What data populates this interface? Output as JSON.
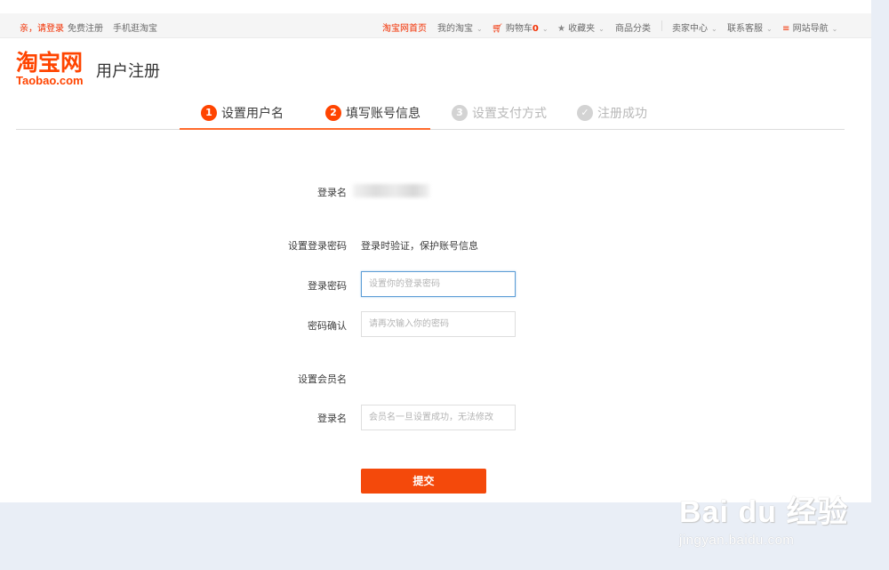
{
  "topbar": {
    "login": "亲，请登录",
    "register": "免费注册",
    "mobile": "手机逛淘宝",
    "home": "淘宝网首页",
    "my_taobao": "我的淘宝",
    "cart_label": "购物车",
    "cart_count": "0",
    "favorites": "收藏夹",
    "categories": "商品分类",
    "seller_center": "卖家中心",
    "customer_service": "联系客服",
    "site_nav": "网站导航"
  },
  "logo": {
    "cn": "淘宝网",
    "en": "Taobao.com"
  },
  "page_title": "用户注册",
  "steps": [
    {
      "num": "1",
      "label": "设置用户名",
      "state": "done"
    },
    {
      "num": "2",
      "label": "填写账号信息",
      "state": "current"
    },
    {
      "num": "3",
      "label": "设置支付方式",
      "state": "pending"
    },
    {
      "num": "✓",
      "label": "注册成功",
      "state": "pending"
    }
  ],
  "form": {
    "login_name_label": "登录名",
    "set_password_label": "设置登录密码",
    "set_password_desc": "登录时验证，保护账号信息",
    "password_label": "登录密码",
    "password_placeholder": "设置你的登录密码",
    "confirm_label": "密码确认",
    "confirm_placeholder": "请再次输入你的密码",
    "member_section_label": "设置会员名",
    "member_name_label": "登录名",
    "member_name_placeholder": "会员名一旦设置成功，无法修改",
    "submit_label": "提交"
  },
  "watermark": {
    "big": "Bai du 经验",
    "small": "jingyan.baidu.com"
  },
  "colors": {
    "brand": "#ff4400",
    "accent_button": "#f4490b",
    "focus_border": "#5c9dd6"
  }
}
